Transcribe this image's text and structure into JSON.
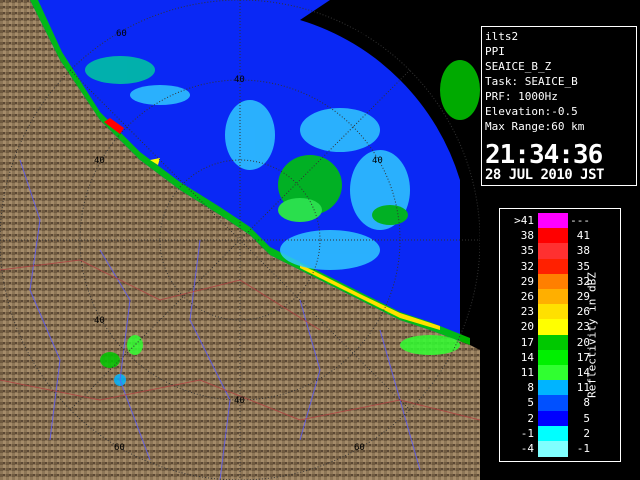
{
  "info": {
    "radar_name": "ilts2",
    "scan_type": "PPI",
    "product": "SEAICE_B_Z",
    "task": "Task: SEAICE_B",
    "prf": "PRF: 1000Hz",
    "elevation": "Elevation:-0.5",
    "max_range": "Max Range:60 km",
    "time": "21:34:36",
    "date": "28 JUL 2010 JST"
  },
  "range_ring_labels": [
    "60",
    "60",
    "40",
    "40",
    "40",
    "40",
    "40",
    "60",
    "60"
  ],
  "legend": {
    "title": "Reflectivity in dBZ",
    "left_labels": [
      ">41",
      "38",
      "35",
      "32",
      "29",
      "26",
      "23",
      "20",
      "17",
      "14",
      "11",
      "8",
      "5",
      "2",
      "-1",
      "-4"
    ],
    "right_labels": [
      "---",
      "41",
      "38",
      "35",
      "32",
      "29",
      "26",
      "23",
      "20",
      "17",
      "14",
      "11",
      "8",
      "5",
      "2",
      "-1"
    ],
    "colors": [
      "#ff00ff",
      "#ff0000",
      "#ff3030",
      "#ff2000",
      "#ff7f00",
      "#ffaf00",
      "#ffe000",
      "#ffff00",
      "#00c800",
      "#00f000",
      "#30ff30",
      "#00b4ff",
      "#0050ff",
      "#0000ff",
      "#00ffff",
      "#80ffff"
    ]
  },
  "colors": {
    "sea": "#0a28f5",
    "land": "#8b7355",
    "grid": "#555555"
  }
}
